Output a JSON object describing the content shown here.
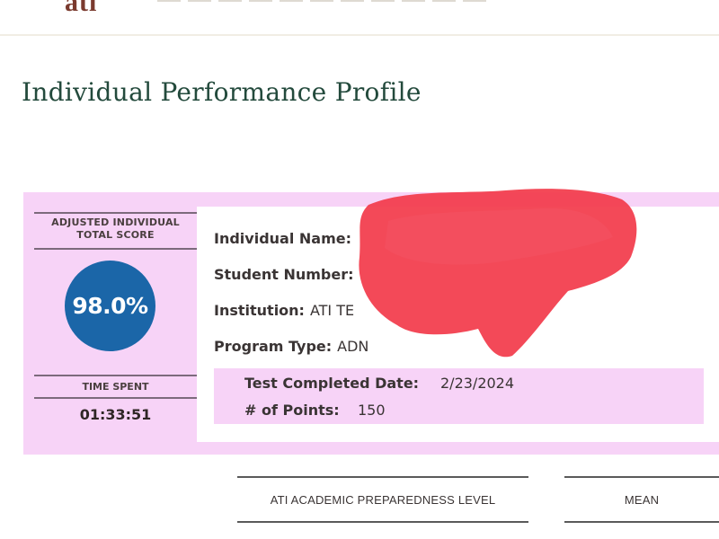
{
  "header": {
    "logo_text": "ati"
  },
  "page": {
    "title": "Individual Performance Profile"
  },
  "score_panel": {
    "score_label": "ADJUSTED INDIVIDUAL TOTAL SCORE",
    "score_value": "98.0%",
    "time_label": "TIME SPENT",
    "time_value": "01:33:51"
  },
  "profile": {
    "name_label": "Individual Name:",
    "student_number_label": "Student Number:",
    "institution_label": "Institution:",
    "institution_value": "ATI TE",
    "program_type_label": "Program Type:",
    "program_type_value": "ADN",
    "test_completed_label": "Test Completed Date:",
    "test_completed_value": "2/23/2024",
    "points_label": "# of Points:",
    "points_value": "150"
  },
  "table_headers": [
    "ATI ACADEMIC PREPAREDNESS LEVEL",
    "MEAN"
  ],
  "colors": {
    "title": "#234a3c",
    "panel_bg": "#f7d3f7",
    "score_circle": "#1b66a8",
    "redaction": "#f23a4a"
  }
}
